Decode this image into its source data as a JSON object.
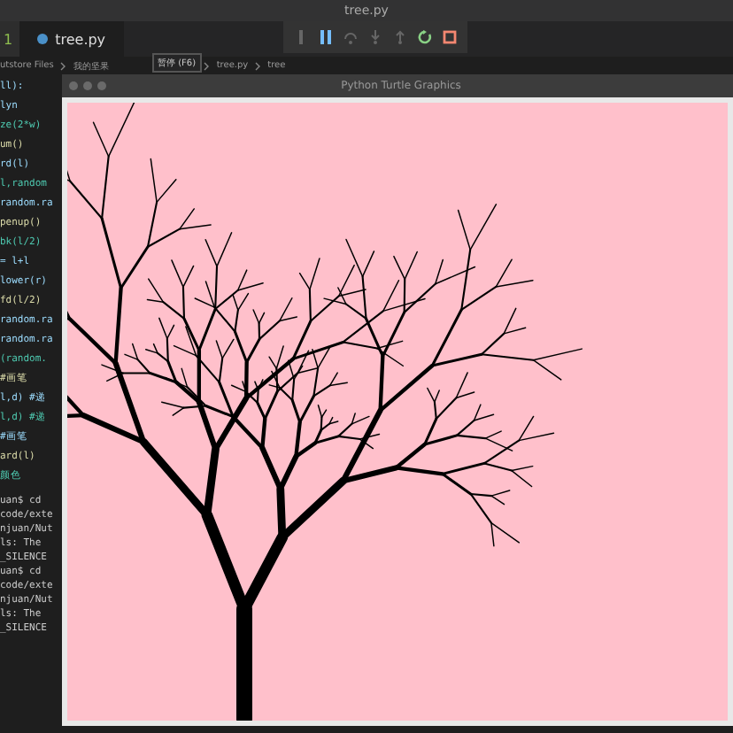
{
  "window": {
    "title": "tree.py"
  },
  "tabs": [
    {
      "label": "1",
      "selected": false
    },
    {
      "label": "tree.py",
      "selected": true
    }
  ],
  "debug_toolbar": {
    "tooltip": "暂停 (F6)"
  },
  "breadcrumbs": [
    "utstore Files",
    "我的坚果",
    "tree.py",
    "tree"
  ],
  "code_lines": [
    "ll):",
    "lyn",
    "ze(2*w)",
    "um()",
    "rd(l)",
    "l,random",
    "random.ra",
    "penup()",
    "bk(l/2)",
    "= l+l",
    "lower(r)",
    "fd(l/2)",
    "random.ra",
    "random.ra",
    "(random.",
    "#画笔",
    "l,d) #递",
    "l,d) #递",
    "#画笔",
    "ard(l)",
    "颜色"
  ],
  "terminal_lines": [
    "uan$ cd",
    "code/exte",
    "njuan/Nut",
    "ls: The",
    "_SILENCE",
    "uan$ cd",
    "code/exte",
    "njuan/Nut",
    "ls: The",
    "_SILENCE"
  ],
  "turtle_window": {
    "title": "Python Turtle Graphics"
  }
}
